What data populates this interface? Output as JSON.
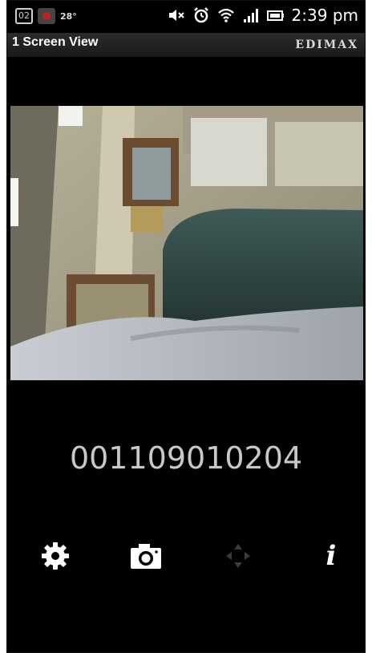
{
  "status_bar": {
    "calendar_day": "02",
    "temperature": "28°",
    "time": "2:39 pm",
    "icons": [
      "calendar-icon",
      "weather-icon",
      "mute-icon",
      "alarm-icon",
      "wifi-icon",
      "signal-icon",
      "battery-icon"
    ]
  },
  "app_bar": {
    "title": "1 Screen View",
    "brand": "EDIMAX"
  },
  "camera": {
    "id": "001109010204"
  },
  "toolbar": {
    "buttons": [
      {
        "name": "settings",
        "icon": "gear-icon",
        "enabled": true
      },
      {
        "name": "snapshot",
        "icon": "camera-icon",
        "enabled": true
      },
      {
        "name": "pan-tilt",
        "icon": "move-arrows-icon",
        "enabled": false
      },
      {
        "name": "info",
        "icon": "info-icon",
        "enabled": true,
        "glyph": "i"
      }
    ]
  },
  "colors": {
    "background": "#000000",
    "id_text": "#c8c8c8",
    "disabled_icon": "#3a3a3a"
  }
}
